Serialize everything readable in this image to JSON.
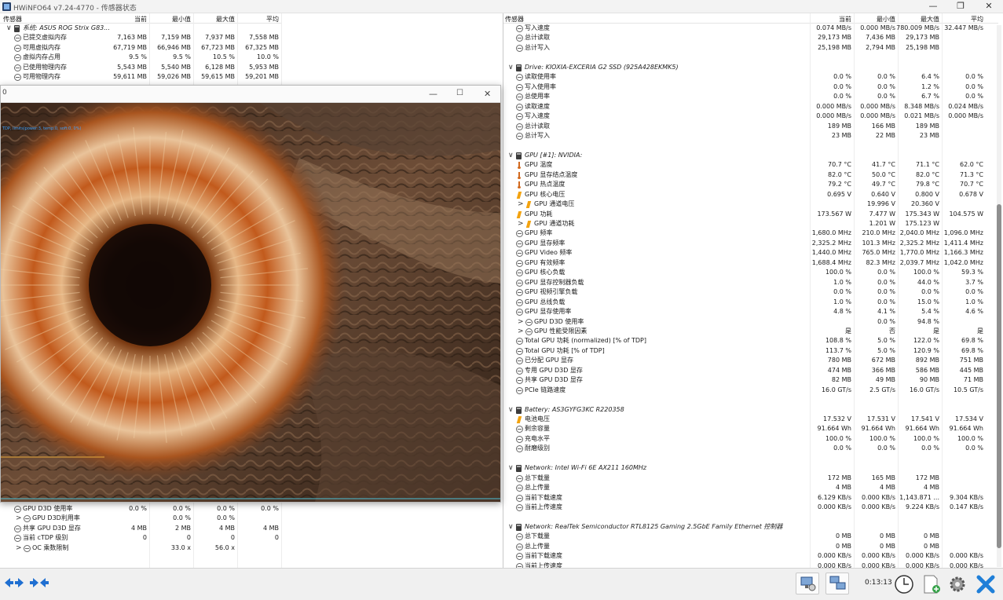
{
  "window": {
    "title": "HWiNFO64 v7.24-4770 - 传感器状态",
    "minimize": "—",
    "maximize": "❐",
    "close": "✕"
  },
  "columns": {
    "sensor": "传感器",
    "current": "当前",
    "min": "最小值",
    "max": "最大值",
    "avg": "平均"
  },
  "left_top_rows": [
    {
      "kind": "group",
      "name": "系统: ASUS ROG Strix G83...",
      "icon": "drive-icon",
      "expander": "∨"
    },
    {
      "kind": "item",
      "name": "已提交虚拟内存",
      "cur": "7,163 MB",
      "min": "7,159 MB",
      "max": "7,937 MB",
      "avg": "7,558 MB",
      "icon": "circle-icon"
    },
    {
      "kind": "item",
      "name": "可用虚拟内存",
      "cur": "67,719 MB",
      "min": "66,946 MB",
      "max": "67,723 MB",
      "avg": "67,325 MB",
      "icon": "circle-icon"
    },
    {
      "kind": "item",
      "name": "虚拟内存占用",
      "cur": "9.5 %",
      "min": "9.5 %",
      "max": "10.5 %",
      "avg": "10.0 %",
      "icon": "circle-icon"
    },
    {
      "kind": "item",
      "name": "已使用物理内存",
      "cur": "5,543 MB",
      "min": "5,540 MB",
      "max": "6,128 MB",
      "avg": "5,953 MB",
      "icon": "circle-icon"
    },
    {
      "kind": "item",
      "name": "可用物理内存",
      "cur": "59,611 MB",
      "min": "59,026 MB",
      "max": "59,615 MB",
      "avg": "59,201 MB",
      "icon": "circle-icon"
    }
  ],
  "left_bottom_rows": [
    {
      "kind": "item",
      "name": "GPU D3D 使用率",
      "cur": "0.0 %",
      "min": "0.0 %",
      "max": "0.0 %",
      "avg": "0.0 %",
      "icon": "circle-icon"
    },
    {
      "kind": "sub",
      "name": "GPU D3D利用率",
      "cur": "",
      "min": "0.0 %",
      "max": "0.0 %",
      "avg": "",
      "icon": "circle-icon",
      "expander": ">"
    },
    {
      "kind": "item",
      "name": "共享 GPU D3D 显存",
      "cur": "4 MB",
      "min": "2 MB",
      "max": "4 MB",
      "avg": "4 MB",
      "icon": "circle-icon"
    },
    {
      "kind": "item",
      "name": "当前 cTDP 级别",
      "cur": "0",
      "min": "0",
      "max": "0",
      "avg": "0",
      "icon": "circle-icon"
    },
    {
      "kind": "sub",
      "name": "OC 乘数限制",
      "cur": "",
      "min": "33.0 x",
      "max": "56.0 x",
      "avg": "",
      "icon": "circle-icon",
      "expander": ">"
    }
  ],
  "overlay": {
    "min": "—",
    "max": "☐",
    "close": "✕",
    "caption": "0",
    "hud_text": "TDP, limits(power:3, temp:0, soft:0, 0%)"
  },
  "right_rows": [
    {
      "kind": "item",
      "name": "写入速度",
      "cur": "0.074 MB/s",
      "min": "0.000 MB/s",
      "max": "780.009 MB/s",
      "avg": "32.447 MB/s",
      "icon": "circle-icon"
    },
    {
      "kind": "item",
      "name": "总计读取",
      "cur": "29,173 MB",
      "min": "7,436 MB",
      "max": "29,173 MB",
      "avg": "",
      "icon": "circle-icon"
    },
    {
      "kind": "item",
      "name": "总计写入",
      "cur": "25,198 MB",
      "min": "2,794 MB",
      "max": "25,198 MB",
      "avg": "",
      "icon": "circle-icon"
    },
    {
      "kind": "blank"
    },
    {
      "kind": "group",
      "name": "Drive: KIOXIA-EXCERIA G2 SSD (925A428EKMK5)",
      "icon": "drive-icon",
      "expander": "∨"
    },
    {
      "kind": "item",
      "name": "读取使用率",
      "cur": "0.0 %",
      "min": "0.0 %",
      "max": "6.4 %",
      "avg": "0.0 %",
      "icon": "circle-icon"
    },
    {
      "kind": "item",
      "name": "写入使用率",
      "cur": "0.0 %",
      "min": "0.0 %",
      "max": "1.2 %",
      "avg": "0.0 %",
      "icon": "circle-icon"
    },
    {
      "kind": "item",
      "name": "总使用率",
      "cur": "0.0 %",
      "min": "0.0 %",
      "max": "6.7 %",
      "avg": "0.0 %",
      "icon": "circle-icon"
    },
    {
      "kind": "item",
      "name": "读取速度",
      "cur": "0.000 MB/s",
      "min": "0.000 MB/s",
      "max": "8.348 MB/s",
      "avg": "0.024 MB/s",
      "icon": "circle-icon"
    },
    {
      "kind": "item",
      "name": "写入速度",
      "cur": "0.000 MB/s",
      "min": "0.000 MB/s",
      "max": "0.021 MB/s",
      "avg": "0.000 MB/s",
      "icon": "circle-icon"
    },
    {
      "kind": "item",
      "name": "总计读取",
      "cur": "189 MB",
      "min": "166 MB",
      "max": "189 MB",
      "avg": "",
      "icon": "circle-icon"
    },
    {
      "kind": "item",
      "name": "总计写入",
      "cur": "23 MB",
      "min": "22 MB",
      "max": "23 MB",
      "avg": "",
      "icon": "circle-icon"
    },
    {
      "kind": "blank"
    },
    {
      "kind": "group",
      "name": "GPU [#1]: NVIDIA:",
      "icon": "drive-icon",
      "expander": "∨"
    },
    {
      "kind": "item",
      "name": "GPU 温度",
      "cur": "70.7 °C",
      "min": "41.7 °C",
      "max": "71.1 °C",
      "avg": "62.0 °C",
      "icon": "thermometer-icon"
    },
    {
      "kind": "item",
      "name": "GPU 显存结点温度",
      "cur": "82.0 °C",
      "min": "50.0 °C",
      "max": "82.0 °C",
      "avg": "71.3 °C",
      "icon": "thermometer-icon"
    },
    {
      "kind": "item",
      "name": "GPU 热点温度",
      "cur": "79.2 °C",
      "min": "49.7 °C",
      "max": "79.8 °C",
      "avg": "70.7 °C",
      "icon": "thermometer-icon"
    },
    {
      "kind": "item",
      "name": "GPU 核心电压",
      "cur": "0.695 V",
      "min": "0.640 V",
      "max": "0.800 V",
      "avg": "0.678 V",
      "icon": "bolt-icon"
    },
    {
      "kind": "sub",
      "name": "GPU 通道电压",
      "cur": "",
      "min": "19.996 V",
      "max": "20.360 V",
      "avg": "",
      "icon": "bolt-icon",
      "expander": ">"
    },
    {
      "kind": "item",
      "name": "GPU 功耗",
      "cur": "173.567 W",
      "min": "7.477 W",
      "max": "175.343 W",
      "avg": "104.575 W",
      "icon": "bolt-icon"
    },
    {
      "kind": "sub",
      "name": "GPU 通道功耗",
      "cur": "",
      "min": "1.201 W",
      "max": "175.123 W",
      "avg": "",
      "icon": "bolt-icon",
      "expander": ">"
    },
    {
      "kind": "item",
      "name": "GPU 频率",
      "cur": "1,680.0 MHz",
      "min": "210.0 MHz",
      "max": "2,040.0 MHz",
      "avg": "1,096.0 MHz",
      "icon": "circle-icon"
    },
    {
      "kind": "item",
      "name": "GPU 显存频率",
      "cur": "2,325.2 MHz",
      "min": "101.3 MHz",
      "max": "2,325.2 MHz",
      "avg": "1,411.4 MHz",
      "icon": "circle-icon"
    },
    {
      "kind": "item",
      "name": "GPU Video 频率",
      "cur": "1,440.0 MHz",
      "min": "765.0 MHz",
      "max": "1,770.0 MHz",
      "avg": "1,166.3 MHz",
      "icon": "circle-icon"
    },
    {
      "kind": "item",
      "name": "GPU 有效频率",
      "cur": "1,688.4 MHz",
      "min": "82.3 MHz",
      "max": "2,039.7 MHz",
      "avg": "1,042.0 MHz",
      "icon": "circle-icon"
    },
    {
      "kind": "item",
      "name": "GPU 核心负载",
      "cur": "100.0 %",
      "min": "0.0 %",
      "max": "100.0 %",
      "avg": "59.3 %",
      "icon": "circle-icon"
    },
    {
      "kind": "item",
      "name": "GPU 显存控制器负载",
      "cur": "1.0 %",
      "min": "0.0 %",
      "max": "44.0 %",
      "avg": "3.7 %",
      "icon": "circle-icon"
    },
    {
      "kind": "item",
      "name": "GPU 视频引擎负载",
      "cur": "0.0 %",
      "min": "0.0 %",
      "max": "0.0 %",
      "avg": "0.0 %",
      "icon": "circle-icon"
    },
    {
      "kind": "item",
      "name": "GPU 总线负载",
      "cur": "1.0 %",
      "min": "0.0 %",
      "max": "15.0 %",
      "avg": "1.0 %",
      "icon": "circle-icon"
    },
    {
      "kind": "item",
      "name": "GPU 显存使用率",
      "cur": "4.8 %",
      "min": "4.1 %",
      "max": "5.4 %",
      "avg": "4.6 %",
      "icon": "circle-icon"
    },
    {
      "kind": "sub",
      "name": "GPU D3D 使用率",
      "cur": "",
      "min": "0.0 %",
      "max": "94.8 %",
      "avg": "",
      "icon": "circle-icon",
      "expander": ">"
    },
    {
      "kind": "sub",
      "name": "GPU 性能受限因素",
      "cur": "是",
      "min": "否",
      "max": "是",
      "avg": "是",
      "icon": "circle-icon",
      "expander": ">"
    },
    {
      "kind": "item",
      "name": "Total GPU 功耗 (normalized) [% of TDP]",
      "cur": "108.8 %",
      "min": "5.0 %",
      "max": "122.0 %",
      "avg": "69.8 %",
      "icon": "circle-icon"
    },
    {
      "kind": "item",
      "name": "Total GPU 功耗 [% of TDP]",
      "cur": "113.7 %",
      "min": "5.0 %",
      "max": "120.9 %",
      "avg": "69.8 %",
      "icon": "circle-icon"
    },
    {
      "kind": "item",
      "name": "已分配 GPU 显存",
      "cur": "780 MB",
      "min": "672 MB",
      "max": "892 MB",
      "avg": "751 MB",
      "icon": "circle-icon"
    },
    {
      "kind": "item",
      "name": "专用 GPU D3D 显存",
      "cur": "474 MB",
      "min": "366 MB",
      "max": "586 MB",
      "avg": "445 MB",
      "icon": "circle-icon"
    },
    {
      "kind": "item",
      "name": "共享 GPU D3D 显存",
      "cur": "82 MB",
      "min": "49 MB",
      "max": "90 MB",
      "avg": "71 MB",
      "icon": "circle-icon"
    },
    {
      "kind": "item",
      "name": "PCIe 链路速度",
      "cur": "16.0 GT/s",
      "min": "2.5 GT/s",
      "max": "16.0 GT/s",
      "avg": "10.5 GT/s",
      "icon": "circle-icon"
    },
    {
      "kind": "blank"
    },
    {
      "kind": "group",
      "name": "Battery: AS3GYFG3KC R220358",
      "icon": "drive-icon",
      "expander": "∨"
    },
    {
      "kind": "item",
      "name": "电池电压",
      "cur": "17.532 V",
      "min": "17.531 V",
      "max": "17.541 V",
      "avg": "17.534 V",
      "icon": "bolt-icon"
    },
    {
      "kind": "item",
      "name": "剩余容量",
      "cur": "91.664 Wh",
      "min": "91.664 Wh",
      "max": "91.664 Wh",
      "avg": "91.664 Wh",
      "icon": "circle-icon"
    },
    {
      "kind": "item",
      "name": "充电水平",
      "cur": "100.0 %",
      "min": "100.0 %",
      "max": "100.0 %",
      "avg": "100.0 %",
      "icon": "circle-icon"
    },
    {
      "kind": "item",
      "name": "耐磨级别",
      "cur": "0.0 %",
      "min": "0.0 %",
      "max": "0.0 %",
      "avg": "0.0 %",
      "icon": "circle-icon"
    },
    {
      "kind": "blank"
    },
    {
      "kind": "group",
      "name": "Network: Intel Wi-Fi 6E AX211 160MHz",
      "icon": "drive-icon",
      "expander": "∨"
    },
    {
      "kind": "item",
      "name": "总下载量",
      "cur": "172 MB",
      "min": "165 MB",
      "max": "172 MB",
      "avg": "",
      "icon": "circle-icon"
    },
    {
      "kind": "item",
      "name": "总上传量",
      "cur": "4 MB",
      "min": "4 MB",
      "max": "4 MB",
      "avg": "",
      "icon": "circle-icon"
    },
    {
      "kind": "item",
      "name": "当前下载速度",
      "cur": "6.129 KB/s",
      "min": "0.000 KB/s",
      "max": "1,143.871 ...",
      "avg": "9.304 KB/s",
      "icon": "circle-icon"
    },
    {
      "kind": "item",
      "name": "当前上传速度",
      "cur": "0.000 KB/s",
      "min": "0.000 KB/s",
      "max": "9.224 KB/s",
      "avg": "0.147 KB/s",
      "icon": "circle-icon"
    },
    {
      "kind": "blank"
    },
    {
      "kind": "group",
      "name": "Network: RealTek Semiconductor RTL8125 Gaming 2.5GbE Family Ethernet 控制器",
      "icon": "drive-icon",
      "expander": "∨"
    },
    {
      "kind": "item",
      "name": "总下载量",
      "cur": "0 MB",
      "min": "0 MB",
      "max": "0 MB",
      "avg": "",
      "icon": "circle-icon"
    },
    {
      "kind": "item",
      "name": "总上传量",
      "cur": "0 MB",
      "min": "0 MB",
      "max": "0 MB",
      "avg": "",
      "icon": "circle-icon"
    },
    {
      "kind": "item",
      "name": "当前下载速度",
      "cur": "0.000 KB/s",
      "min": "0.000 KB/s",
      "max": "0.000 KB/s",
      "avg": "0.000 KB/s",
      "icon": "circle-icon"
    },
    {
      "kind": "item",
      "name": "当前上传速度",
      "cur": "0.000 KB/s",
      "min": "0.000 KB/s",
      "max": "0.000 KB/s",
      "avg": "0.000 KB/s",
      "icon": "circle-icon"
    }
  ],
  "toolbar": {
    "timer": "0:13:13",
    "buttons": [
      "nav-arrows-icon",
      "collapse-arrows-icon",
      "network-config-icon",
      "network-icon",
      "clock-icon",
      "log-add-icon",
      "settings-icon",
      "close-icon"
    ]
  },
  "colors": {
    "accent_blue": "#1f6fd1",
    "temp_orange": "#d2691e",
    "bolt_yellow": "#f3a30f",
    "close_red_blue": "#1f7fd8"
  }
}
